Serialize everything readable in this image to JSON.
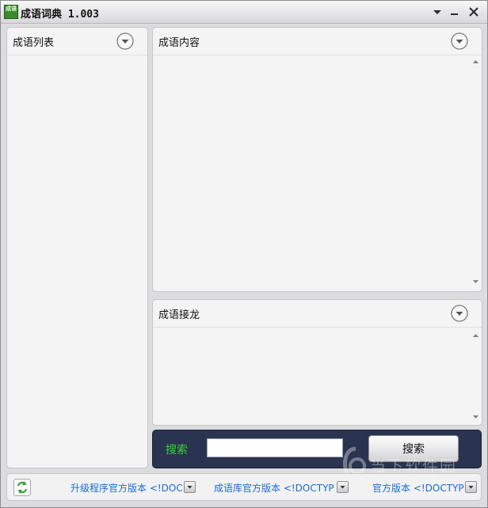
{
  "window": {
    "title": "成语词典 1.003",
    "icon_label": "成语"
  },
  "panels": {
    "list": {
      "title": "成语列表"
    },
    "content": {
      "title": "成语内容"
    },
    "chain": {
      "title": "成语接龙"
    }
  },
  "search": {
    "label": "搜索",
    "input_value": "",
    "button_label": "搜索",
    "label_color": "#34d234"
  },
  "statusbar": {
    "links": [
      {
        "label": "升级程序官方版本 <!DOC"
      },
      {
        "label": "成语库官方版本 <!DOCTYP"
      },
      {
        "label": "官方版本 <!DOCTYP"
      }
    ]
  },
  "watermark": {
    "text": "当下软件园",
    "sub": "www.downxia.com"
  }
}
